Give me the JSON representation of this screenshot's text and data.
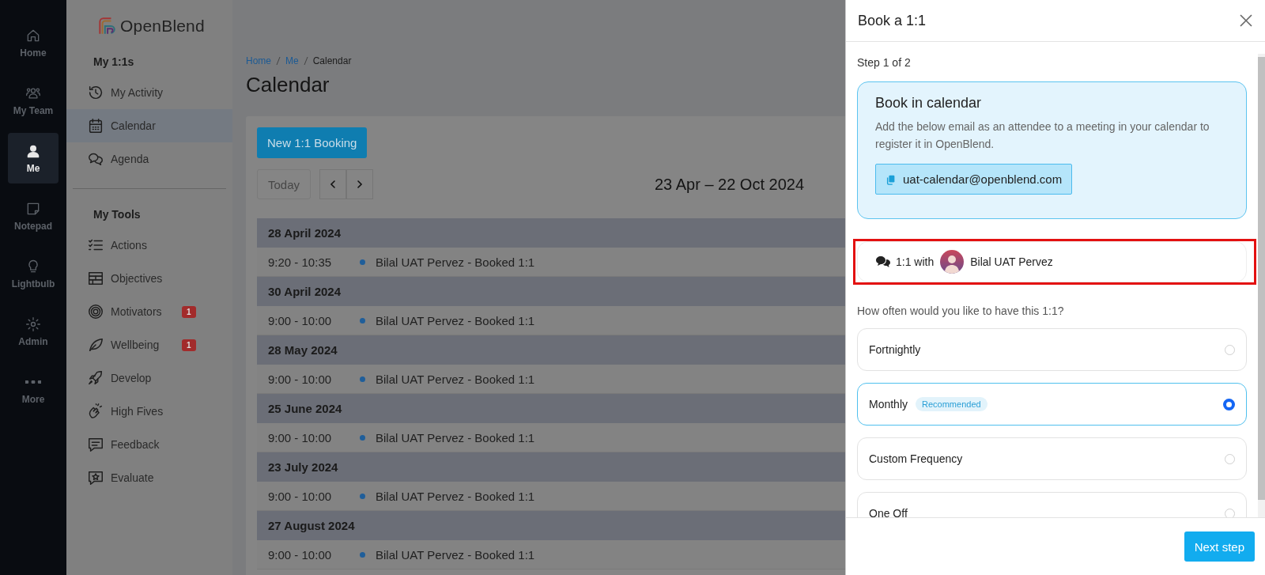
{
  "rail": [
    {
      "label": "Home",
      "selected": false
    },
    {
      "label": "My Team",
      "selected": false
    },
    {
      "label": "Me",
      "selected": true
    },
    {
      "label": "Notepad",
      "selected": false
    },
    {
      "label": "Lightbulb",
      "selected": false
    },
    {
      "label": "Admin",
      "selected": false
    },
    {
      "label": "More",
      "selected": false
    }
  ],
  "sidebar": {
    "logo": "OpenBlend",
    "sections": [
      {
        "title": "My 1:1s",
        "items": [
          {
            "label": "My Activity",
            "selected": false
          },
          {
            "label": "Calendar",
            "selected": true
          },
          {
            "label": "Agenda",
            "selected": false
          }
        ]
      },
      {
        "title": "My Tools",
        "items": [
          {
            "label": "Actions",
            "selected": false
          },
          {
            "label": "Objectives",
            "selected": false
          },
          {
            "label": "Motivators",
            "selected": false,
            "badge": "1"
          },
          {
            "label": "Wellbeing",
            "selected": false,
            "badge": "1"
          },
          {
            "label": "Develop",
            "selected": false
          },
          {
            "label": "High Fives",
            "selected": false
          },
          {
            "label": "Feedback",
            "selected": false
          },
          {
            "label": "Evaluate",
            "selected": false
          }
        ]
      }
    ]
  },
  "breadcrumb": [
    {
      "label": "Home",
      "link": true
    },
    {
      "label": "Me",
      "link": true
    },
    {
      "label": "Calendar",
      "link": false
    }
  ],
  "page_title": "Calendar",
  "new_booking_button": "New 1:1 Booking",
  "today_button": "Today",
  "date_range": "23 Apr – 22 Oct 2024",
  "agenda": [
    {
      "date": "28 April 2024",
      "events": [
        {
          "time": "9:20 - 10:35",
          "title": "Bilal UAT Pervez - Booked 1:1"
        }
      ]
    },
    {
      "date": "30 April 2024",
      "events": [
        {
          "time": "9:00 - 10:00",
          "title": "Bilal UAT Pervez - Booked 1:1"
        }
      ]
    },
    {
      "date": "28 May 2024",
      "events": [
        {
          "time": "9:00 - 10:00",
          "title": "Bilal UAT Pervez - Booked 1:1"
        }
      ]
    },
    {
      "date": "25 June 2024",
      "events": [
        {
          "time": "9:00 - 10:00",
          "title": "Bilal UAT Pervez - Booked 1:1"
        }
      ]
    },
    {
      "date": "23 July 2024",
      "events": [
        {
          "time": "9:00 - 10:00",
          "title": "Bilal UAT Pervez - Booked 1:1"
        }
      ]
    },
    {
      "date": "27 August 2024",
      "events": [
        {
          "time": "9:00 - 10:00",
          "title": "Bilal UAT Pervez - Booked 1:1"
        }
      ]
    }
  ],
  "panel": {
    "title": "Book a 1:1",
    "step": "Step 1 of 2",
    "info": {
      "title": "Book in calendar",
      "text": "Add the below email as an attendee to a meeting in your calendar to register it in OpenBlend.",
      "email": "uat-calendar@openblend.com"
    },
    "with": {
      "label": "1:1 with",
      "name": "Bilal UAT Pervez",
      "highlighted": true
    },
    "question": "How often would you like to have this 1:1?",
    "options": [
      {
        "label": "Fortnightly",
        "selected": false
      },
      {
        "label": "Monthly",
        "badge": "Recommended",
        "selected": true
      },
      {
        "label": "Custom Frequency",
        "selected": false
      },
      {
        "label": "One Off",
        "selected": false
      }
    ],
    "next_button": "Next step"
  }
}
